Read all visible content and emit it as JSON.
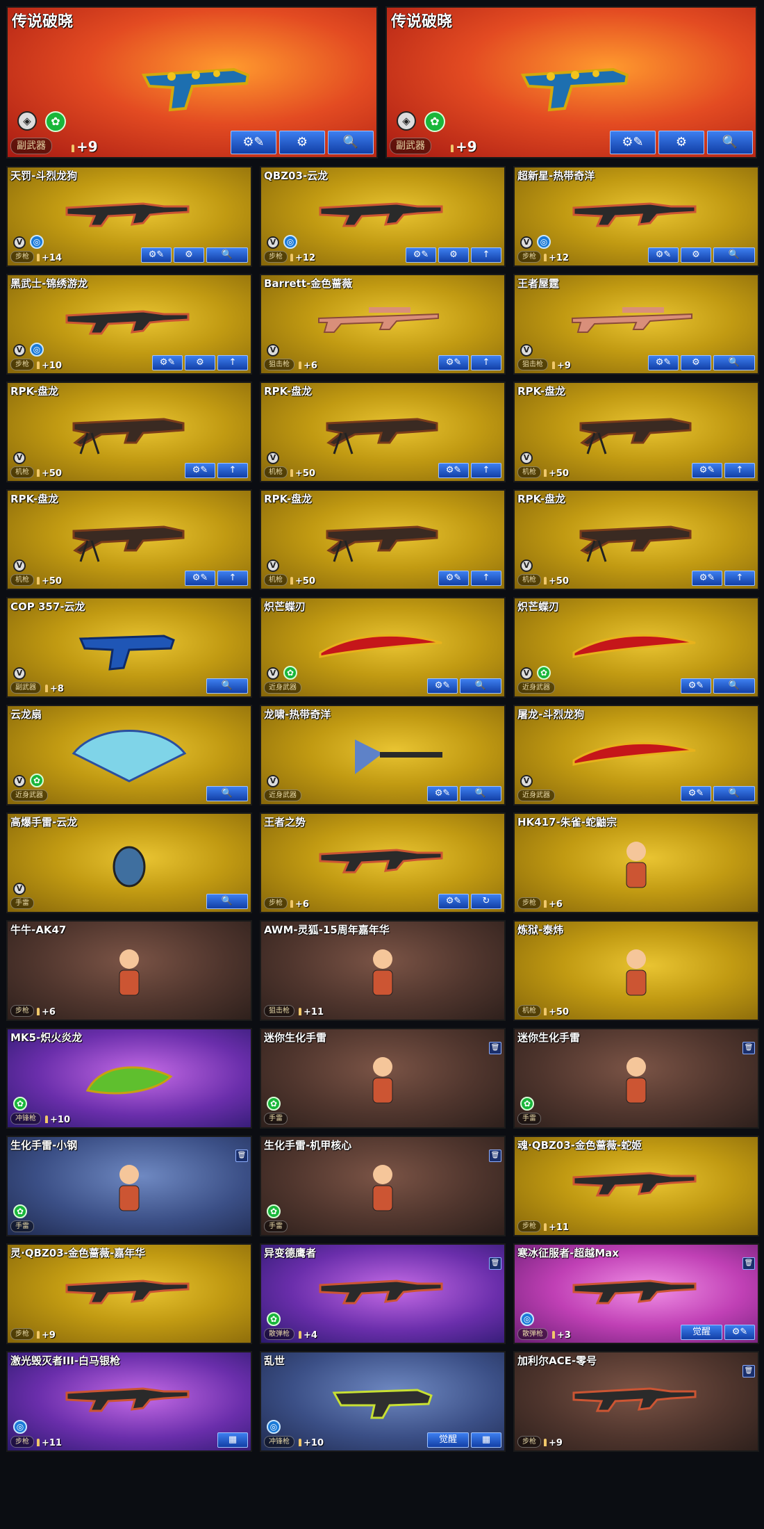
{
  "top_cards": [
    {
      "title": "传说破晓",
      "tag": "副武器",
      "level": "+9",
      "buttons": [
        "⚙✎",
        "⚙",
        "🔍"
      ]
    },
    {
      "title": "传说破晓",
      "tag": "副武器",
      "level": "+9",
      "buttons": [
        "⚙✎",
        "⚙",
        "🔍"
      ]
    }
  ],
  "cards": [
    {
      "title": "天罚-斗烈龙狗",
      "tag": "步枪",
      "level": "+14",
      "buttons": [
        "⚙✎",
        "⚙",
        "🔍"
      ]
    },
    {
      "title": "QBZ03-云龙",
      "tag": "步枪",
      "level": "+12",
      "buttons": [
        "⚙✎",
        "⚙",
        "↑"
      ]
    },
    {
      "title": "超新星-热带奇洋",
      "tag": "步枪",
      "level": "+12",
      "buttons": [
        "⚙✎",
        "⚙",
        "🔍"
      ]
    },
    {
      "title": "黑武士-锦绣游龙",
      "tag": "步枪",
      "level": "+10",
      "buttons": [
        "⚙✎",
        "⚙",
        "↑"
      ]
    },
    {
      "title": "Barrett-金色蔷薇",
      "tag": "狙击枪",
      "level": "+6",
      "buttons": [
        "⚙✎",
        "↑"
      ]
    },
    {
      "title": "王者屋霆",
      "tag": "狙击枪",
      "level": "+9",
      "buttons": [
        "⚙✎",
        "⚙",
        "🔍"
      ]
    },
    {
      "title": "RPK-盘龙",
      "tag": "机枪",
      "level": "+50",
      "buttons": [
        "⚙✎",
        "↑"
      ]
    },
    {
      "title": "RPK-盘龙",
      "tag": "机枪",
      "level": "+50",
      "buttons": [
        "⚙✎",
        "↑"
      ]
    },
    {
      "title": "RPK-盘龙",
      "tag": "机枪",
      "level": "+50",
      "buttons": [
        "⚙✎",
        "↑"
      ]
    },
    {
      "title": "RPK-盘龙",
      "tag": "机枪",
      "level": "+50",
      "buttons": [
        "⚙✎",
        "↑"
      ]
    },
    {
      "title": "RPK-盘龙",
      "tag": "机枪",
      "level": "+50",
      "buttons": [
        "⚙✎",
        "↑"
      ]
    },
    {
      "title": "RPK-盘龙",
      "tag": "机枪",
      "level": "+50",
      "buttons": [
        "⚙✎",
        "↑"
      ]
    },
    {
      "title": "COP 357-云龙",
      "tag": "副武器",
      "level": "+8",
      "buttons": [
        "🔍"
      ]
    },
    {
      "title": "炽芒蝶刃",
      "tag": "近身武器",
      "level": "",
      "buttons": [
        "⚙✎",
        "🔍"
      ]
    },
    {
      "title": "炽芒蝶刃",
      "tag": "近身武器",
      "level": "",
      "buttons": [
        "⚙✎",
        "🔍"
      ]
    },
    {
      "title": "云龙扇",
      "tag": "近身武器",
      "level": "",
      "buttons": [
        "🔍"
      ]
    },
    {
      "title": "龙啸-热带奇洋",
      "tag": "近身武器",
      "level": "",
      "buttons": [
        "⚙✎",
        "🔍"
      ]
    },
    {
      "title": "屠龙-斗烈龙狗",
      "tag": "近身武器",
      "level": "",
      "buttons": [
        "⚙✎",
        "🔍"
      ]
    },
    {
      "title": "高爆手雷-云龙",
      "tag": "手雷",
      "level": "",
      "buttons": [
        "🔍"
      ]
    },
    {
      "title": "王者之势",
      "tag": "步枪",
      "level": "+6",
      "buttons": [
        "⚙✎",
        "↻"
      ]
    },
    {
      "title": "HK417-朱雀-蛇鼬宗",
      "tag": "步枪",
      "level": "+6",
      "buttons": []
    },
    {
      "title": "牛牛-AK47",
      "tag": "步枪",
      "level": "+6",
      "buttons": []
    },
    {
      "title": "AWM-灵狐-15周年嘉年华",
      "tag": "狙击枪",
      "level": "+11",
      "buttons": []
    },
    {
      "title": "炼狱-泰炜",
      "tag": "机枪",
      "level": "+50",
      "buttons": []
    },
    {
      "title": "MK5-炽火炎龙",
      "tag": "冲锋枪",
      "level": "+10",
      "buttons": []
    },
    {
      "title": "迷你生化手雷",
      "tag": "手雷",
      "level": "",
      "buttons": []
    },
    {
      "title": "迷你生化手雷",
      "tag": "手雷",
      "level": "",
      "buttons": []
    },
    {
      "title": "生化手雷-小钢",
      "tag": "手雷",
      "level": "",
      "buttons": []
    },
    {
      "title": "生化手雷-机甲核心",
      "tag": "手雷",
      "level": "",
      "buttons": []
    },
    {
      "title": "魂·QBZ03-金色蔷薇-蛇姬",
      "tag": "步枪",
      "level": "+11",
      "buttons": []
    },
    {
      "title": "灵·QBZ03-金色蔷薇-嘉年华",
      "tag": "步枪",
      "level": "+9",
      "buttons": []
    },
    {
      "title": "异变德鹰者",
      "tag": "散弹枪",
      "level": "+4",
      "buttons": []
    },
    {
      "title": "寒冰征服者-超越Max",
      "tag": "散弹枪",
      "level": "+3",
      "buttons": [
        "觉醒",
        "⚙✎"
      ]
    },
    {
      "title": "激光毁灭者III-白马银枪",
      "tag": "步枪",
      "level": "+11",
      "buttons": [
        "▦"
      ]
    },
    {
      "title": "乱世",
      "tag": "冲锋枪",
      "level": "+10",
      "buttons": [
        "觉醒",
        "▦"
      ]
    },
    {
      "title": "加利尔ACE-零号",
      "tag": "步枪",
      "level": "+9",
      "buttons": []
    }
  ]
}
